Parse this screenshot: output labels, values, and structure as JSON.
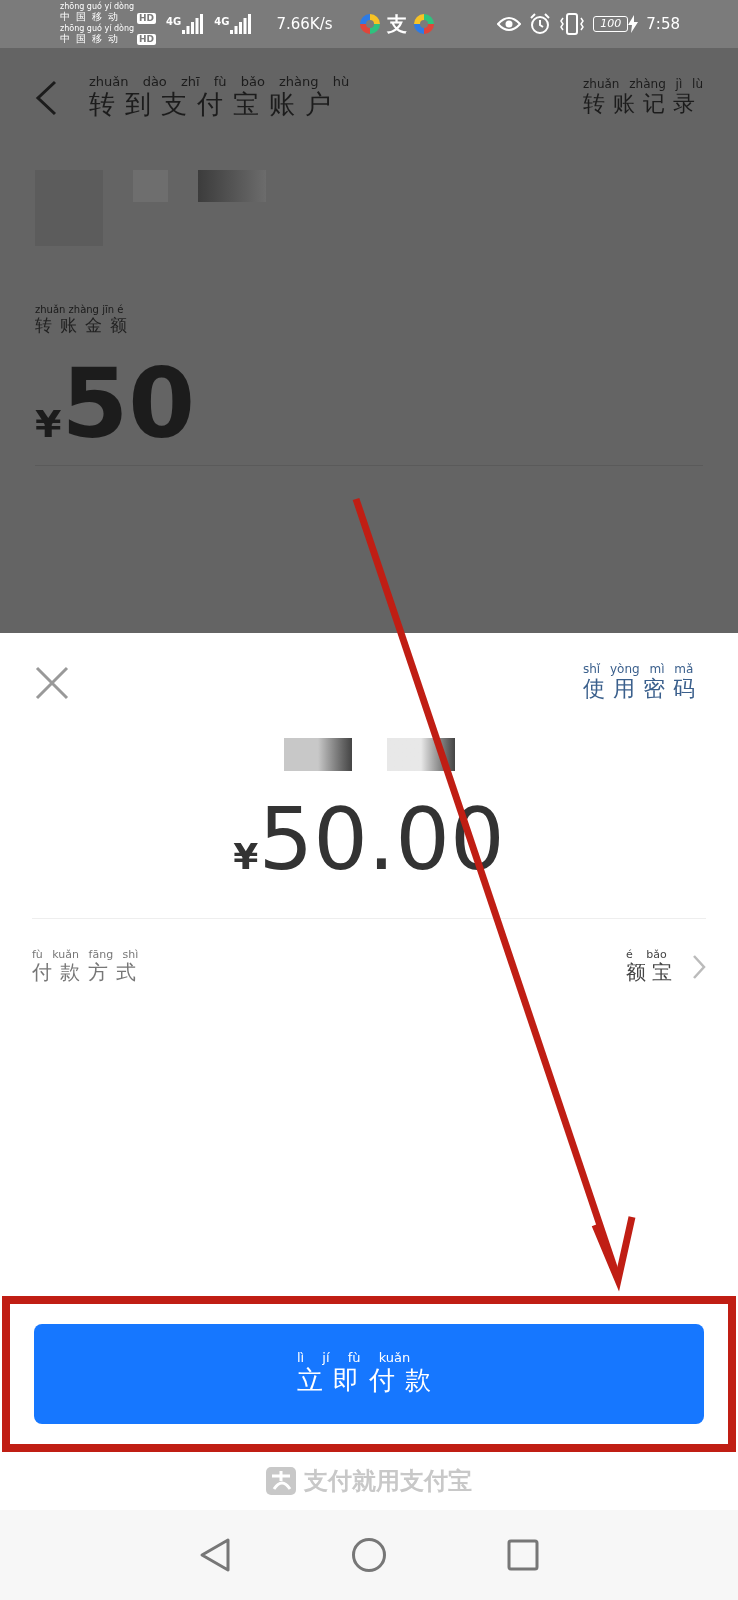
{
  "status_bar": {
    "carriers": [
      {
        "name": "中国移动",
        "pinyin": "zhōng guó yí dòng",
        "badge": "HD"
      },
      {
        "name": "中国移动",
        "pinyin": "zhōng guó yí dòng",
        "badge": "HD"
      }
    ],
    "networks": [
      "4G",
      "4G"
    ],
    "speed": "7.66K/s",
    "app_badge": "支",
    "battery": "100",
    "time": "7:58"
  },
  "header": {
    "title": {
      "text": "转到支付宝账户",
      "pinyin": "zhuǎn dào zhī fù bǎo zhàng hù"
    },
    "action": {
      "text": "转账记录",
      "pinyin": "zhuǎn zhàng jì lù"
    }
  },
  "transfer": {
    "amount_label": {
      "text": "转账金额",
      "pinyin": "zhuǎn zhàng jīn é"
    },
    "currency": "¥",
    "amount": "50"
  },
  "sheet": {
    "password_link": {
      "text": "使用密码",
      "pinyin": "shǐ yòng mì mǎ"
    },
    "currency": "¥",
    "amount": "50.00",
    "payment_method": {
      "label": {
        "text": "付款方式",
        "pinyin": "fù kuǎn fāng shì"
      },
      "value": {
        "text": "额宝",
        "pinyin": "é bǎo"
      }
    },
    "pay_button": {
      "text": "立即付款",
      "pinyin": "lì jí fù kuǎn"
    },
    "footer": "支付就用支付宝"
  }
}
